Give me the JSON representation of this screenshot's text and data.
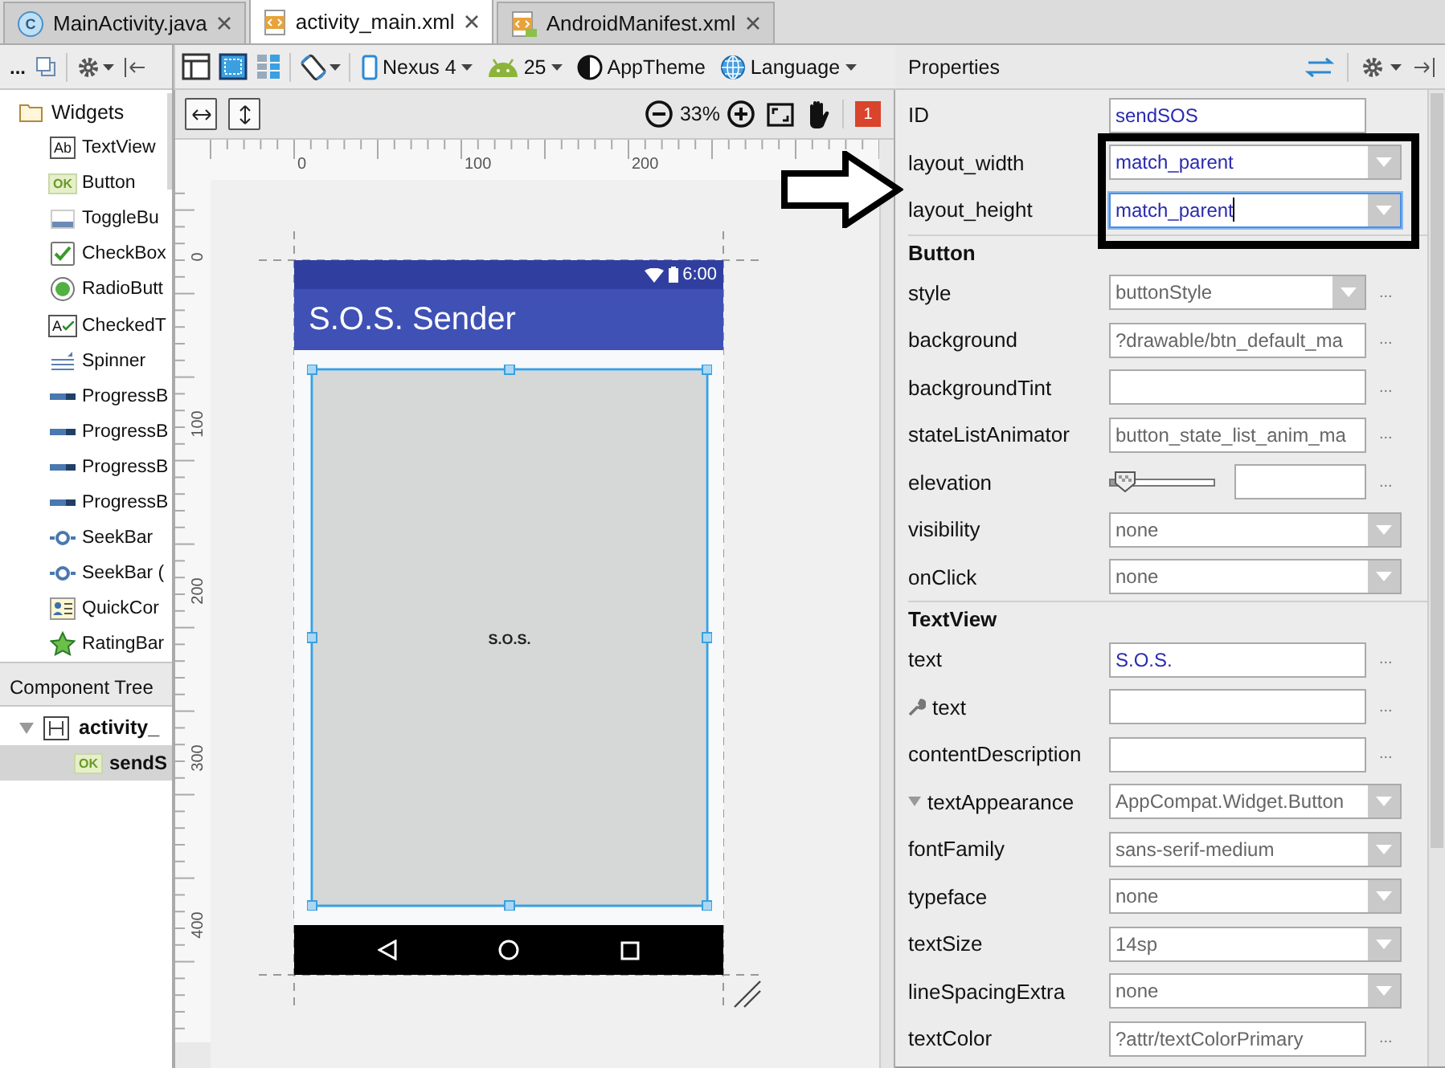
{
  "tabs": [
    {
      "label": "MainActivity.java",
      "kind": "java",
      "icon_text": "C",
      "selected": false
    },
    {
      "label": "activity_main.xml",
      "kind": "xml",
      "selected": true
    },
    {
      "label": "AndroidManifest.xml",
      "kind": "manifest",
      "selected": false
    }
  ],
  "toolbar": {
    "more": "...",
    "device": "Nexus 4",
    "api": "25",
    "theme": "AppTheme",
    "language": "Language",
    "zoom": "33%",
    "error_count": "1"
  },
  "palette": {
    "header": "Widgets",
    "items": [
      {
        "label": "TextView",
        "kind": "textview",
        "icon_text": "Ab"
      },
      {
        "label": "Button",
        "kind": "button",
        "icon_text": "OK"
      },
      {
        "label": "ToggleBu",
        "kind": "toggle"
      },
      {
        "label": "CheckBox",
        "kind": "checkbox"
      },
      {
        "label": "RadioButt",
        "kind": "radio"
      },
      {
        "label": "CheckedT",
        "kind": "checkedtext",
        "icon_text": "A"
      },
      {
        "label": "Spinner",
        "kind": "spinner"
      },
      {
        "label": "ProgressB",
        "kind": "progress"
      },
      {
        "label": "ProgressB",
        "kind": "progress"
      },
      {
        "label": "ProgressB",
        "kind": "progress"
      },
      {
        "label": "ProgressB",
        "kind": "progress"
      },
      {
        "label": "SeekBar",
        "kind": "seekbar"
      },
      {
        "label": "SeekBar (",
        "kind": "seekbar"
      },
      {
        "label": "QuickCor",
        "kind": "quickcontact"
      },
      {
        "label": "RatingBar",
        "kind": "rating"
      }
    ]
  },
  "component_tree": {
    "title": "Component Tree",
    "items": [
      {
        "label": "activity_",
        "selected": false,
        "expanded": true,
        "children": [
          {
            "label": "sendS",
            "icon_text": "OK",
            "selected": true
          }
        ]
      }
    ]
  },
  "rulers": {
    "horizontal": [
      "0",
      "100",
      "200"
    ],
    "vertical": [
      "0",
      "100",
      "200",
      "300",
      "400"
    ]
  },
  "phone": {
    "time": "6:00",
    "app_title": "S.O.S. Sender",
    "button_text": "S.O.S."
  },
  "properties": {
    "title": "Properties",
    "rows": [
      {
        "kind": "text",
        "label": "ID",
        "value": "sendSOS",
        "set": true,
        "focused": false
      },
      {
        "kind": "dropdown",
        "label": "layout_width",
        "value": "match_parent",
        "set": true,
        "focused": false
      },
      {
        "kind": "dropdown",
        "label": "layout_height",
        "value": "match_parent",
        "set": true,
        "focused": true
      },
      {
        "kind": "section",
        "label": "Button"
      },
      {
        "kind": "dropdown",
        "label": "style",
        "value": "buttonStyle",
        "set": false,
        "focused": false,
        "more": "..."
      },
      {
        "kind": "text",
        "label": "background",
        "value": "?drawable/btn_default_ma",
        "set": false,
        "focused": false,
        "more": "..."
      },
      {
        "kind": "text",
        "label": "backgroundTint",
        "focused": false,
        "more": "..."
      },
      {
        "kind": "text",
        "label": "stateListAnimator",
        "value": "button_state_list_anim_ma",
        "set": false,
        "focused": false,
        "more": "..."
      },
      {
        "kind": "slider",
        "label": "elevation",
        "level": 0.05,
        "focused": false,
        "more": "..."
      },
      {
        "kind": "dropdown",
        "label": "visibility",
        "value": "none",
        "set": false,
        "focused": false
      },
      {
        "kind": "dropdown",
        "label": "onClick",
        "value": "none",
        "set": false,
        "focused": false
      },
      {
        "kind": "section",
        "label": "TextView"
      },
      {
        "kind": "text",
        "label": "text",
        "value": "S.O.S.",
        "set": true,
        "focused": false,
        "more": "..."
      },
      {
        "kind": "text",
        "label": "text",
        "tool": true,
        "focused": false,
        "more": "..."
      },
      {
        "kind": "text",
        "label": "contentDescription",
        "focused": false,
        "more": "..."
      },
      {
        "kind": "dropdown",
        "label": "textAppearance",
        "value": "AppCompat.Widget.Button",
        "expanded": true,
        "set": false,
        "focused": false
      },
      {
        "kind": "dropdown",
        "label": "fontFamily",
        "value": "sans-serif-medium",
        "set": false,
        "focused": false
      },
      {
        "kind": "dropdown",
        "label": "typeface",
        "value": "none",
        "set": false,
        "focused": false
      },
      {
        "kind": "dropdown",
        "label": "textSize",
        "value": "14sp",
        "set": false,
        "focused": false
      },
      {
        "kind": "dropdown",
        "label": "lineSpacingExtra",
        "value": "none",
        "set": false,
        "focused": false
      },
      {
        "kind": "text",
        "label": "textColor",
        "value": "?attr/textColorPrimary",
        "set": false,
        "focused": false,
        "more": "..."
      }
    ]
  }
}
